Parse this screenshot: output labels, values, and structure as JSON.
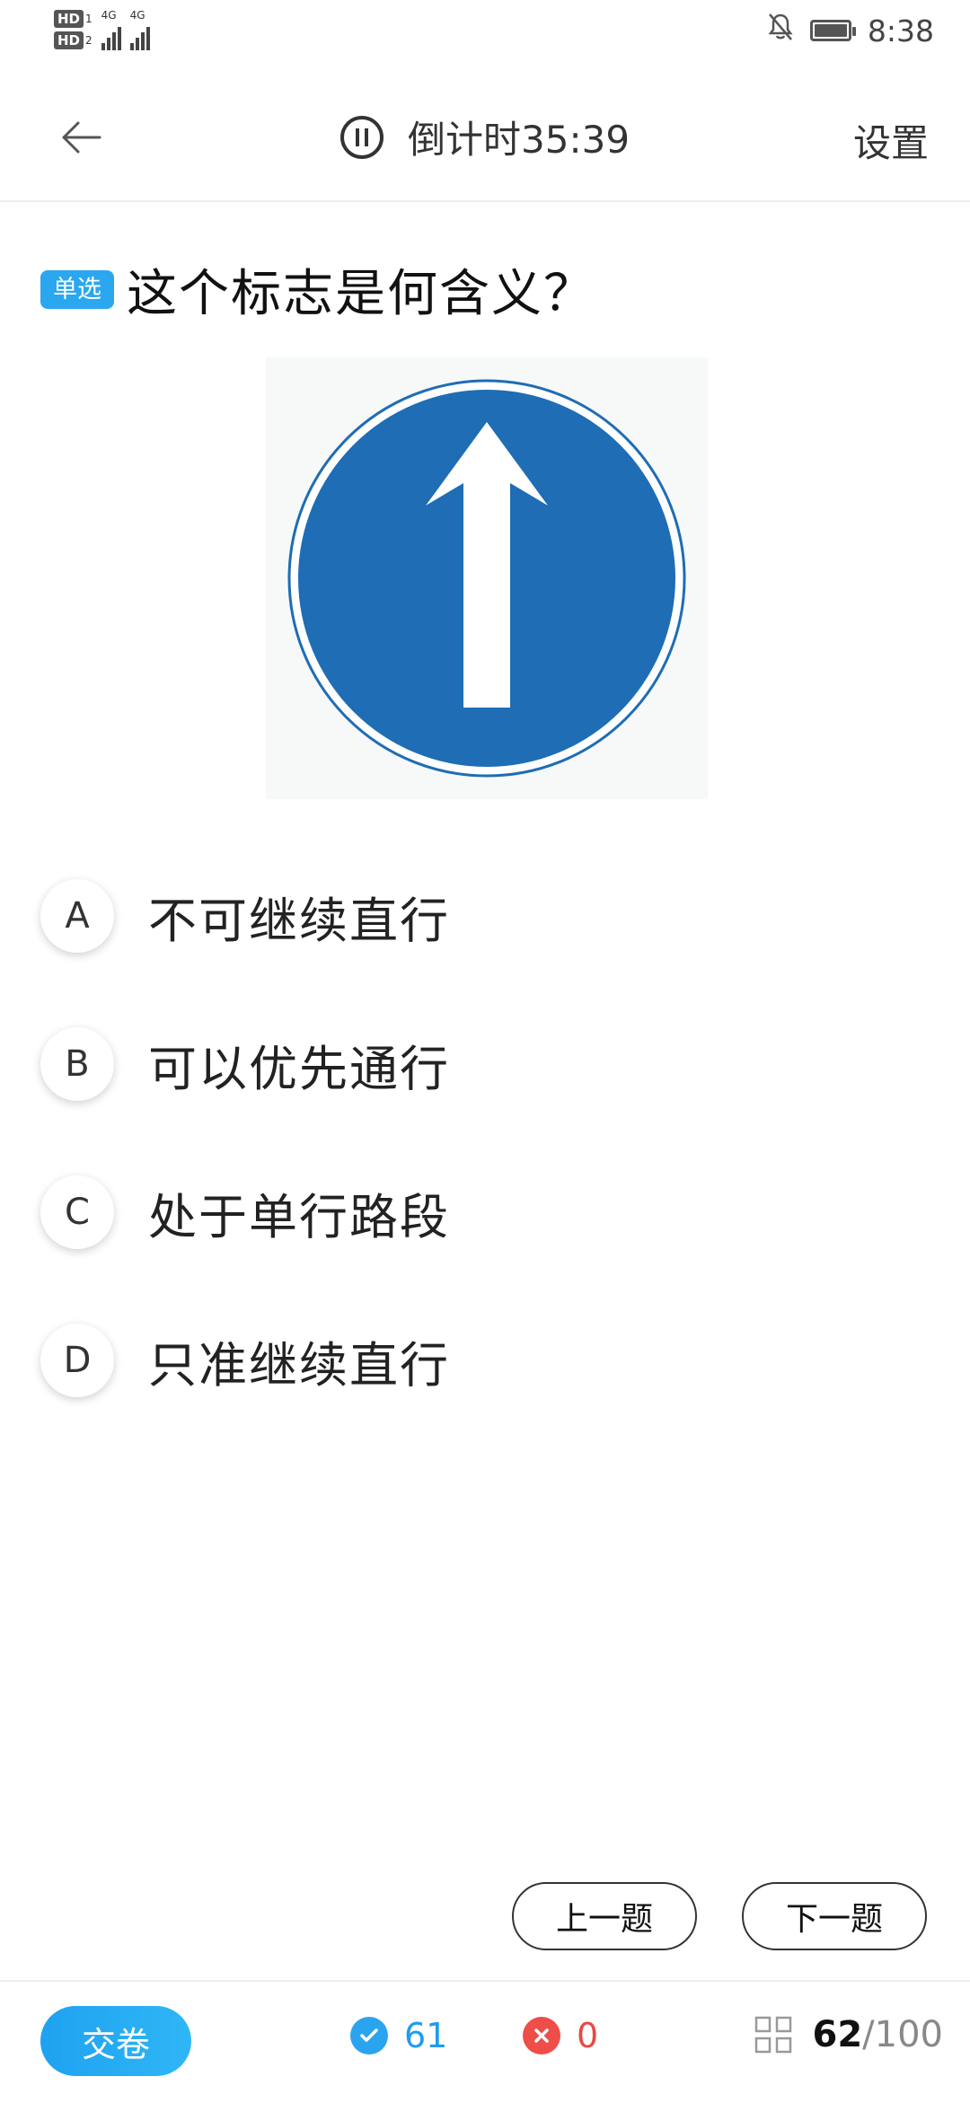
{
  "status_bar": {
    "hd1": "HD",
    "hd1_sub": "1",
    "hd2": "HD",
    "hd2_sub": "2",
    "net1": "4G",
    "net2": "4G",
    "time": "8:38",
    "icons": [
      "bell-off-icon",
      "battery-icon"
    ]
  },
  "header": {
    "back_icon": "arrow-left-icon",
    "pause_icon": "pause-icon",
    "countdown": "倒计时35:39",
    "settings": "设置"
  },
  "question": {
    "type_badge": "单选",
    "text": "这个标志是何含义？",
    "image": "traffic-sign-straight-only"
  },
  "options": [
    {
      "letter": "A",
      "text": "不可继续直行"
    },
    {
      "letter": "B",
      "text": "可以优先通行"
    },
    {
      "letter": "C",
      "text": "处于单行路段"
    },
    {
      "letter": "D",
      "text": "只准继续直行"
    }
  ],
  "nav": {
    "prev": "上一题",
    "next": "下一题"
  },
  "bottom": {
    "submit": "交卷",
    "correct_count": "61",
    "wrong_count": "0",
    "current": "62",
    "total": "/100"
  },
  "colors": {
    "accent": "#2aa7ee",
    "correct": "#1e9cf0",
    "wrong": "#e74a43",
    "sign_blue": "#1e6db5"
  }
}
